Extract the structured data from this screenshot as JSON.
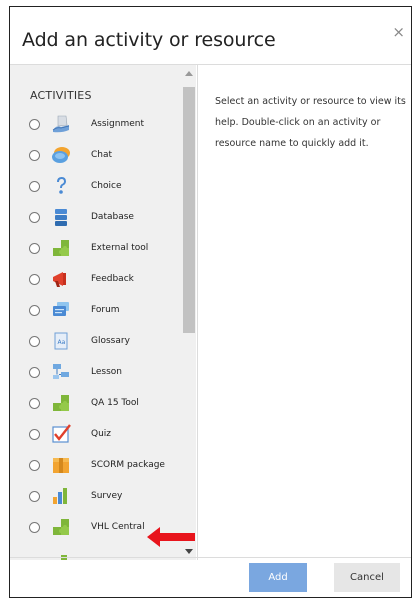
{
  "dialog": {
    "title": "Add an activity or resource",
    "close_glyph": "×"
  },
  "activities": {
    "section_label": "ACTIVITIES",
    "items": [
      {
        "label": "Assignment",
        "icon": "assignment-icon"
      },
      {
        "label": "Chat",
        "icon": "chat-icon"
      },
      {
        "label": "Choice",
        "icon": "choice-icon"
      },
      {
        "label": "Database",
        "icon": "database-icon"
      },
      {
        "label": "External tool",
        "icon": "external-tool-icon"
      },
      {
        "label": "Feedback",
        "icon": "feedback-icon"
      },
      {
        "label": "Forum",
        "icon": "forum-icon"
      },
      {
        "label": "Glossary",
        "icon": "glossary-icon"
      },
      {
        "label": "Lesson",
        "icon": "lesson-icon"
      },
      {
        "label": "QA 15 Tool",
        "icon": "qa-tool-icon"
      },
      {
        "label": "Quiz",
        "icon": "quiz-icon"
      },
      {
        "label": "SCORM package",
        "icon": "scorm-package-icon"
      },
      {
        "label": "Survey",
        "icon": "survey-icon"
      },
      {
        "label": "VHL Central",
        "icon": "vhl-central-icon"
      }
    ]
  },
  "help": {
    "text": "Select an activity or resource to view its help. Double-click on an activity or resource name to quickly add it."
  },
  "footer": {
    "add_label": "Add",
    "cancel_label": "Cancel"
  },
  "colors": {
    "primary_button": "#7aa7e0",
    "annotation_arrow": "#e8141c",
    "list_background": "#f0f0f0"
  }
}
